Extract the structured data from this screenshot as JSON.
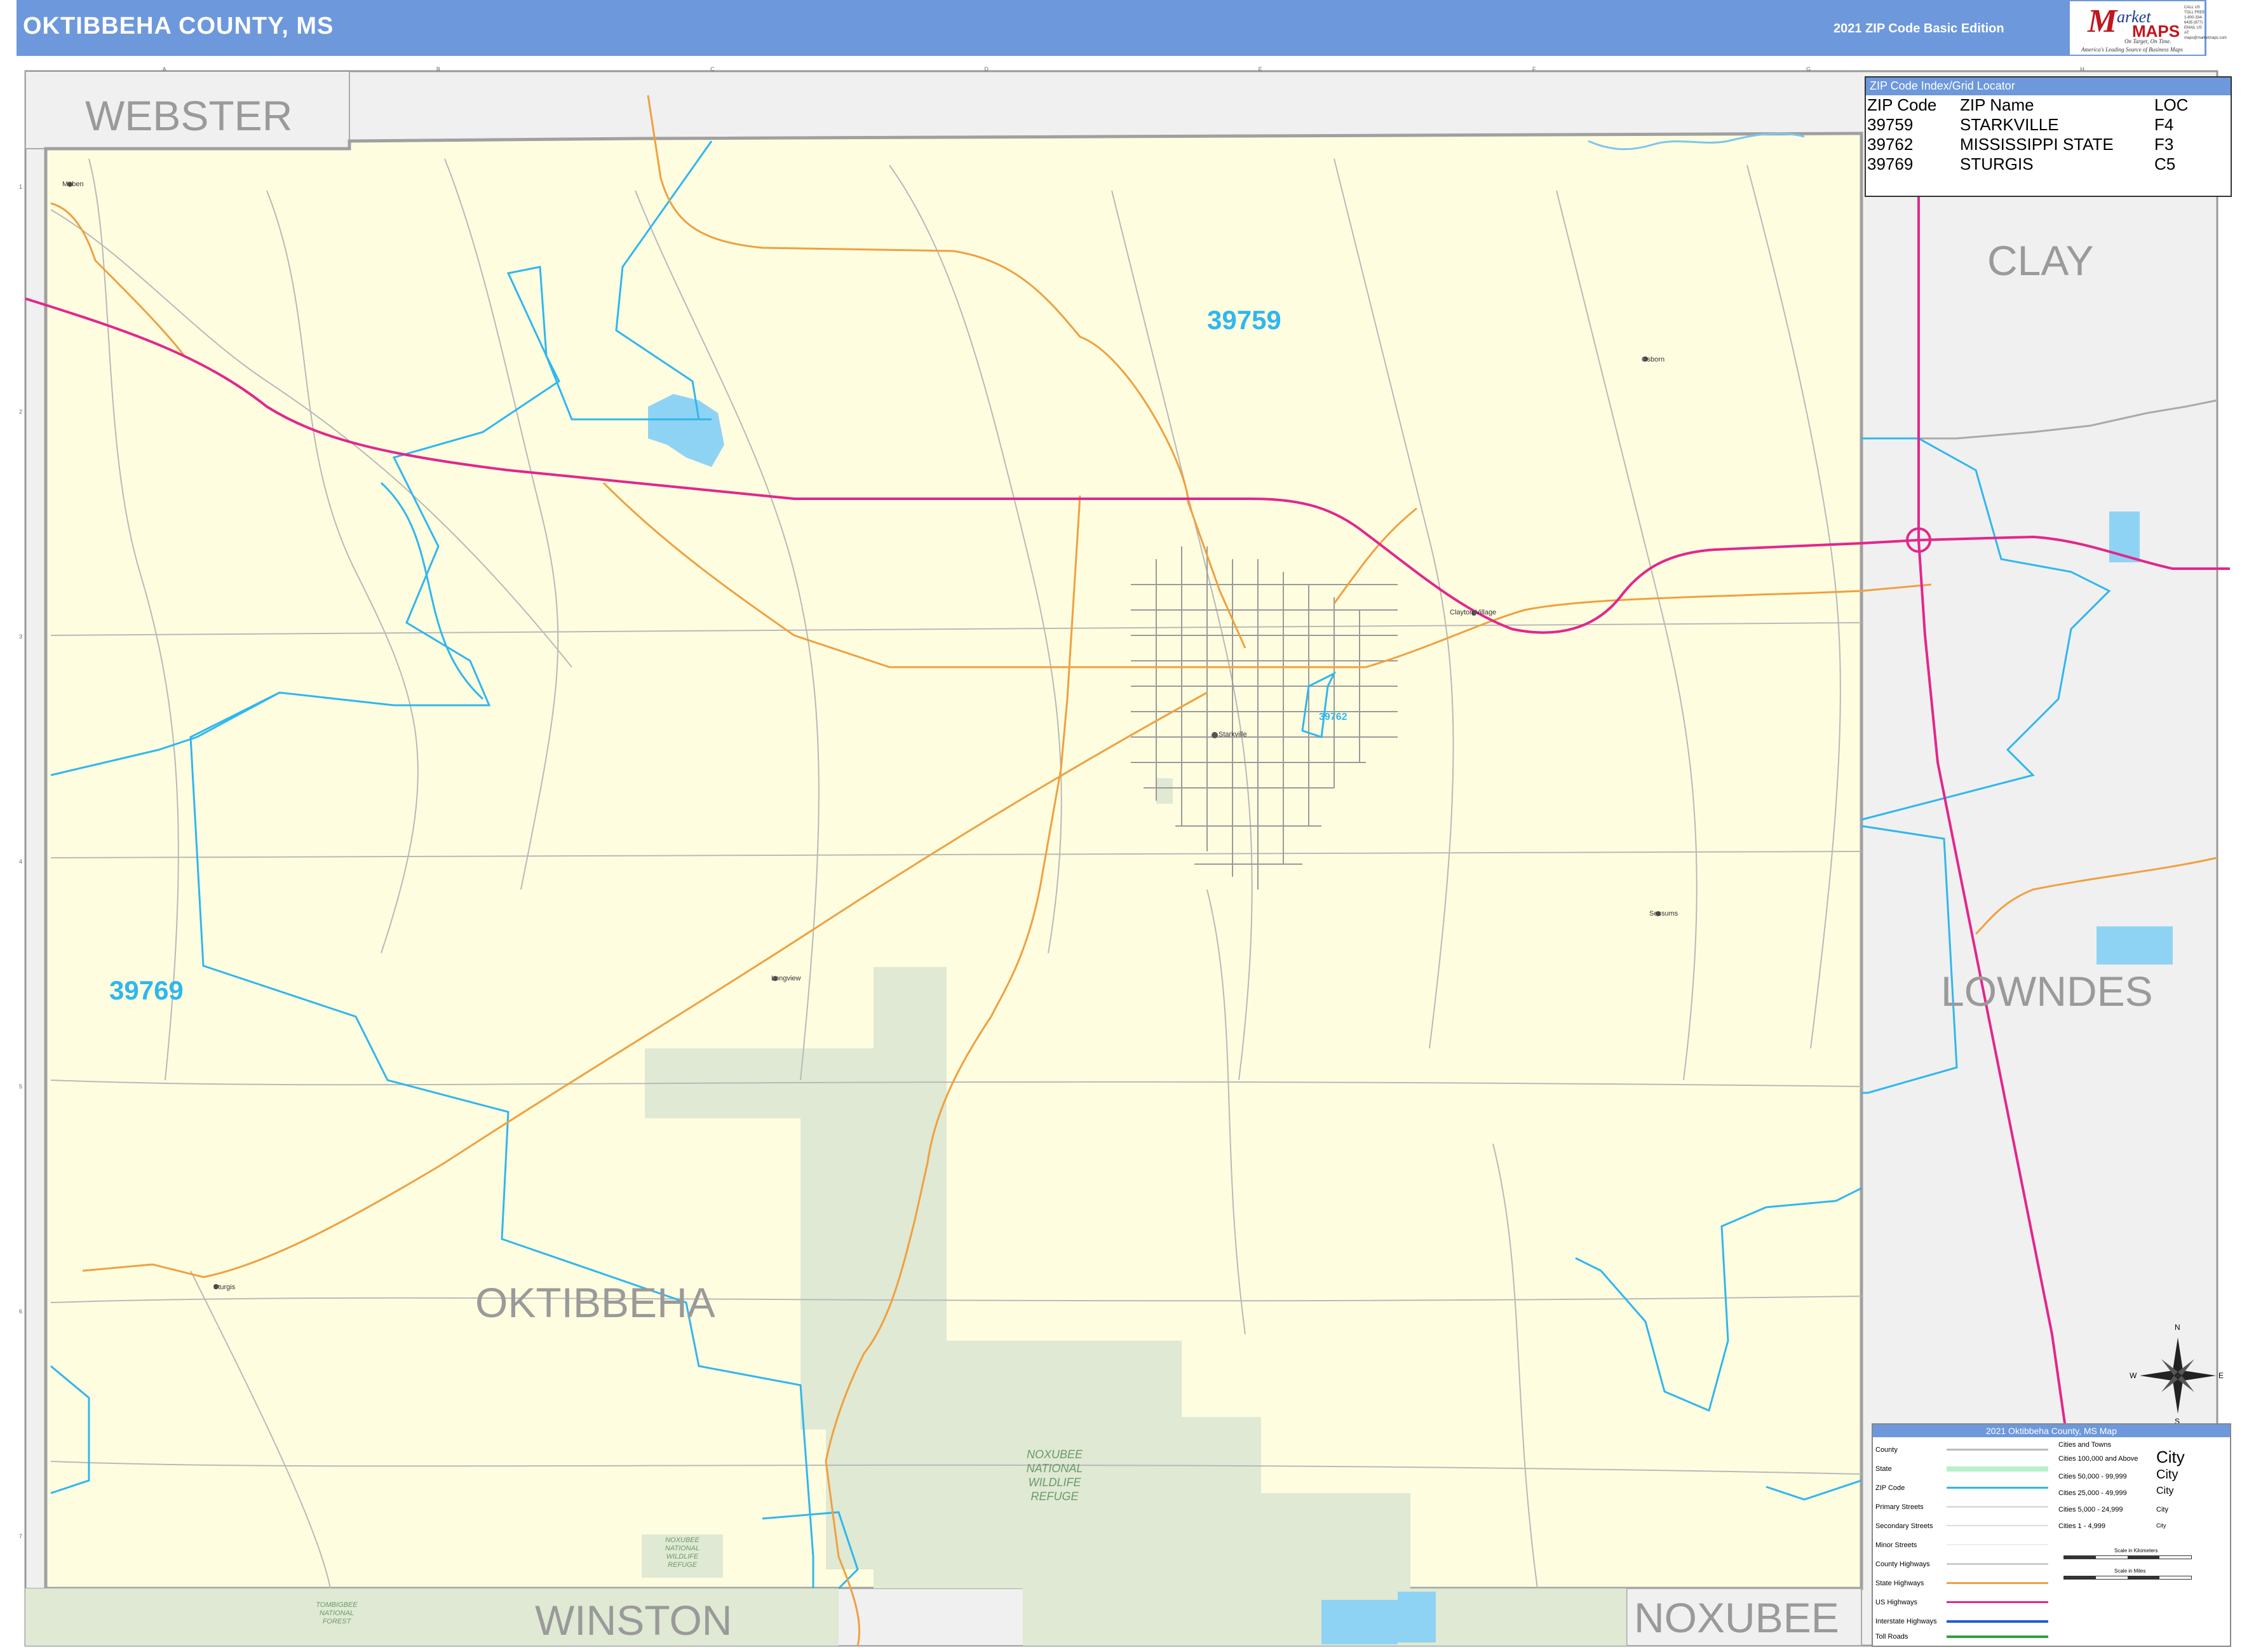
{
  "header": {
    "title": "OKTIBBEHA COUNTY, MS",
    "edition": "2021 ZIP Code Basic Edition"
  },
  "logo": {
    "m": "M",
    "word1": "arket",
    "word2": "MAPS",
    "tagline": "On Target, On Time.",
    "tagline2": "America's Leading Source of Business Maps",
    "contact": [
      "CALL US TOLL FREE",
      "1-800-334-6435 (877)",
      "EMAIL US AT:",
      "maps@marketmaps.com"
    ]
  },
  "zip_index": {
    "title": "ZIP Code Index/Grid Locator",
    "columns": [
      "ZIP Code",
      "ZIP Name",
      "LOC"
    ],
    "rows": [
      [
        "39759",
        "STARKVILLE",
        "F4"
      ],
      [
        "39762",
        "MISSISSIPPI STATE",
        "F3"
      ],
      [
        "39769",
        "STURGIS",
        "C5"
      ]
    ]
  },
  "counties": {
    "webster": "WEBSTER",
    "clay": "CLAY",
    "lowndes": "LOWNDES",
    "oktibbeha": "OKTIBBEHA",
    "winston": "WINSTON",
    "noxubee": "NOXUBEE"
  },
  "zip_labels": {
    "z39759": "39759",
    "z39769": "39769",
    "z39762": "39762"
  },
  "places": {
    "starkville": "Starkville",
    "sturgis": "Sturgis",
    "longview": "Longview",
    "osborn": "Osborn",
    "sessums": "Sessums",
    "maben": "Maben",
    "clayton_village": "Clayton Village"
  },
  "refuge": {
    "main": "NOXUBEE\nNATIONAL\nWILDLIFE\nREFUGE",
    "small": "NOXUBEE\nNATIONAL\nWILDLIFE\nREFUGE",
    "forest": "TOMBIGBEE\nNATIONAL\nFOREST"
  },
  "legend": {
    "title": "2021 Oktibbeha County, MS Map",
    "rows": [
      "County",
      "State",
      "ZIP Code",
      "Primary Streets",
      "Secondary Streets",
      "Minor Streets",
      "County Highways",
      "State Highways",
      "US Highways",
      "Interstate Highways",
      "Toll Roads"
    ],
    "cities_title": "Cities and Towns",
    "cities": [
      "Cities 100,000 and Above",
      "Cities 50,000 - 99,999",
      "Cities 25,000 - 49,999",
      "Cities 5,000 - 24,999",
      "Cities 1 - 4,999"
    ],
    "city_word": "City",
    "scale_km": "Scale in Kilometers",
    "scale_mi": "Scale in Miles"
  },
  "compass": {
    "n": "N",
    "s": "S",
    "e": "E",
    "w": "W"
  },
  "grid_cols": [
    "A",
    "B",
    "C",
    "D",
    "E",
    "F",
    "G",
    "H"
  ],
  "grid_rows": [
    "1",
    "2",
    "3",
    "4",
    "5",
    "6",
    "7"
  ],
  "colors": {
    "county_fill": "#fffde0",
    "outside_fill": "#f0f0f0",
    "refuge_fill": "#dfe9d3",
    "zip_line": "#2fb7ee",
    "us_highway": "#e3268c",
    "state_highway": "#f0a040",
    "water": "#8fd3f4",
    "header": "#6d98dc"
  }
}
